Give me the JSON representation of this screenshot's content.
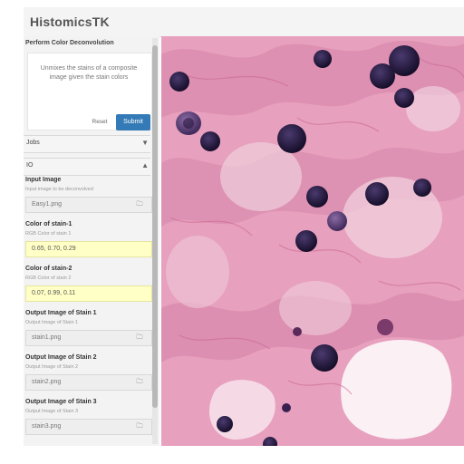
{
  "app": {
    "title": "HistomicsTK"
  },
  "panel": {
    "title": "Perform Color Deconvolution",
    "description": "Unmixes the stains of a composite image given the stain colors",
    "reset_label": "Reset",
    "submit_label": "Submit"
  },
  "jobs_section": {
    "label": "Jobs"
  },
  "io_section": {
    "label": "IO"
  },
  "fields": [
    {
      "label": "Input Image",
      "help": "Input image to be deconvolved",
      "value": "Easy1.png"
    },
    {
      "label": "Color of stain-1",
      "help": "RGB Color of stain 1",
      "value": "0.65, 0.70, 0.29"
    },
    {
      "label": "Color of stain-2",
      "help": "RGB Color of stain 2",
      "value": "0.07, 0.99, 0.11"
    },
    {
      "label": "Output Image of Stain 1",
      "help": "Output Image of Stain 1",
      "value": "stain1.png"
    },
    {
      "label": "Output Image of Stain 2",
      "help": "Output Image of Stain 2",
      "value": "stain2.png"
    },
    {
      "label": "Output Image of Stain 3",
      "help": "Output Image of Stain 3",
      "value": "stain3.png"
    }
  ],
  "icons": {
    "folder": "folder-icon",
    "chevron_down": "chevron-down-icon",
    "chevron_up": "chevron-up-icon"
  },
  "colors": {
    "accent": "#337ab7",
    "color_field_bg": "#ffffc6",
    "tissue_base": "#e7a0bd",
    "nucleus": "#1a1030"
  }
}
